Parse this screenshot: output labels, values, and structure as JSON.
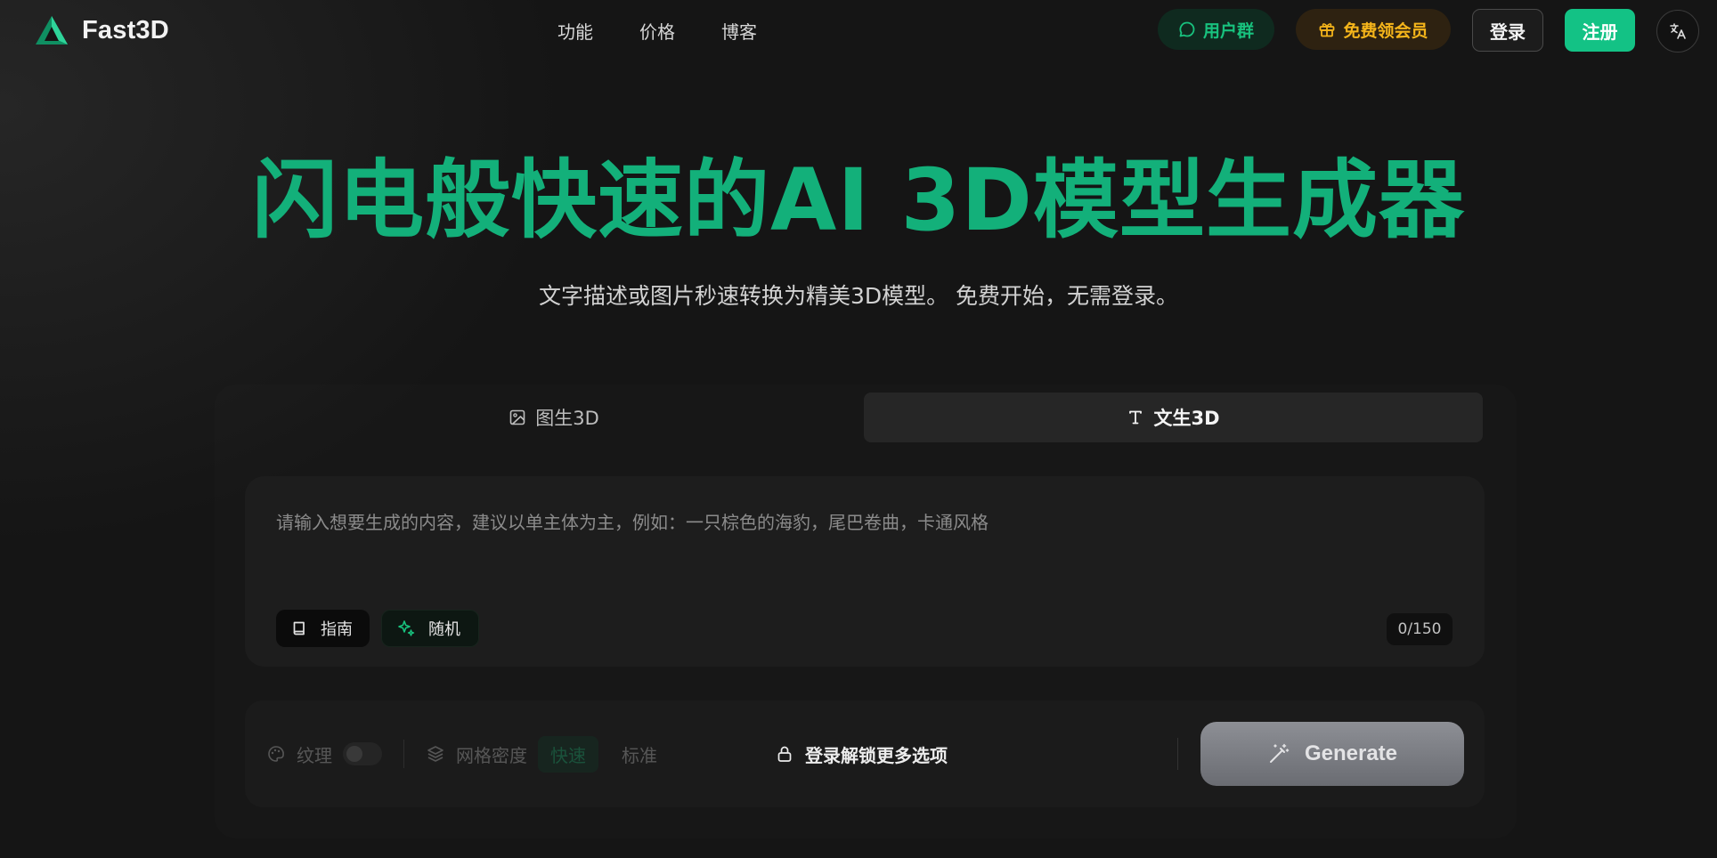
{
  "brand": {
    "name": "Fast3D"
  },
  "nav": {
    "links": [
      "功能",
      "价格",
      "博客"
    ]
  },
  "header": {
    "user_group": "用户群",
    "free_vip": "免费领会员",
    "login": "登录",
    "signup": "注册"
  },
  "hero": {
    "title": "闪电般快速的AI 3D模型生成器",
    "subtitle": "文字描述或图片秒速转换为精美3D模型。 免费开始，无需登录。"
  },
  "tabs": [
    {
      "label": "图生3D",
      "icon": "image-icon",
      "active": false
    },
    {
      "label": "文生3D",
      "icon": "text-icon",
      "active": true
    }
  ],
  "prompt": {
    "placeholder": "请输入想要生成的内容，建议以单主体为主，例如：一只棕色的海豹，尾巴卷曲，卡通风格",
    "guide_label": "指南",
    "random_label": "随机",
    "counter": "0/150"
  },
  "options": {
    "texture_label": "纹理",
    "mesh_density_label": "网格密度",
    "speed_fast": "快速",
    "speed_standard": "标准",
    "unlock_label": "登录解锁更多选项",
    "generate_label": "Generate"
  },
  "colors": {
    "accent": "#13b07a",
    "signup_bg": "#13c285",
    "vip": "#f5b51b",
    "background": "#151515"
  }
}
